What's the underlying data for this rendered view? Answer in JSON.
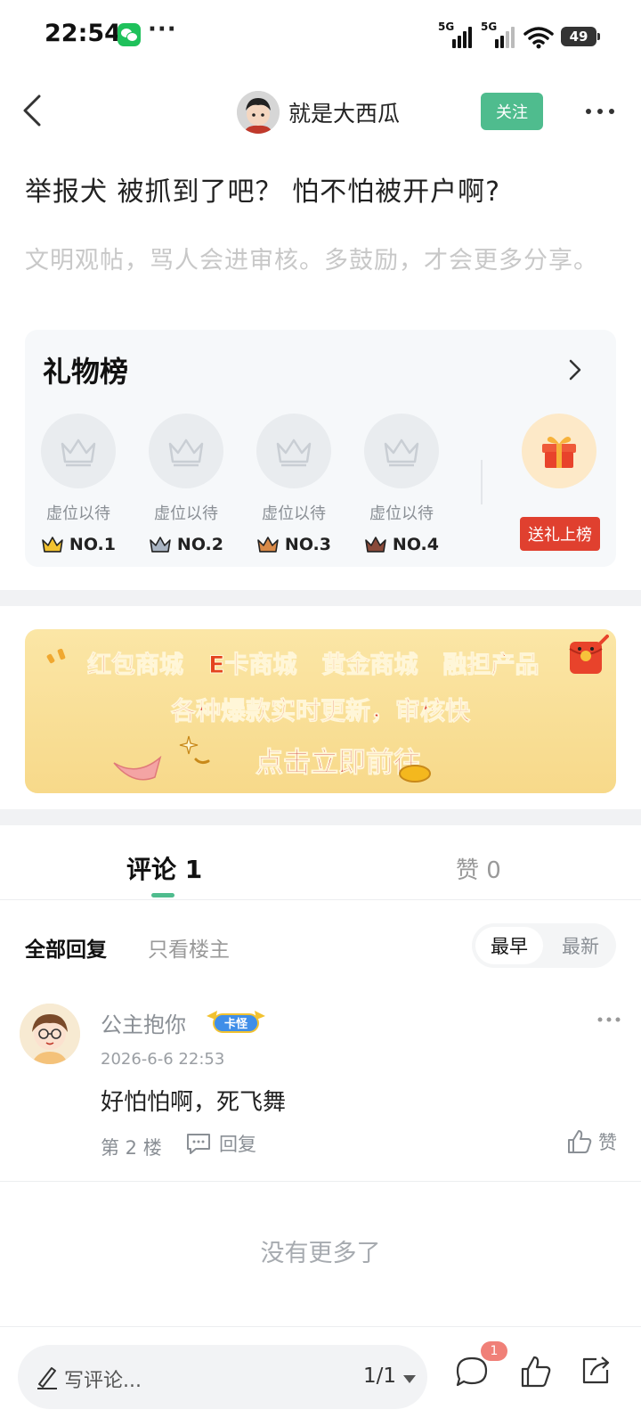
{
  "status_bar": {
    "time": "22:54",
    "more": "···",
    "net1": "5G",
    "net2": "5G",
    "battery": "49"
  },
  "header": {
    "author_name": "就是大西瓜",
    "follow_label": "关注"
  },
  "post": {
    "title": "举报犬 被抓到了吧？ 怕不怕被开户啊?",
    "hint": "文明观帖，骂人会进审核。多鼓励，才会更多分享。"
  },
  "gift_board": {
    "title": "礼物榜",
    "slots": [
      {
        "label": "虚位以待",
        "rank": "NO.1",
        "crown_color": "#f2c230"
      },
      {
        "label": "虚位以待",
        "rank": "NO.2",
        "crown_color": "#a9b4c2"
      },
      {
        "label": "虚位以待",
        "rank": "NO.3",
        "crown_color": "#d98a48"
      },
      {
        "label": "虚位以待",
        "rank": "NO.4",
        "crown_color": "#8a4a3a"
      }
    ],
    "send_label": "送礼上榜"
  },
  "banner": {
    "items": [
      "红包商城",
      "E卡商城",
      "黄金商城",
      "融担产品"
    ],
    "subtitle": "各种爆款实时更新，审核快",
    "cta": "点击立即前往"
  },
  "tabs": {
    "comments": "评论 1",
    "likes": "赞 0"
  },
  "filters": {
    "all": "全部回复",
    "owner_only": "只看楼主",
    "sort_earliest": "最早",
    "sort_latest": "最新"
  },
  "comments": [
    {
      "name": "公主抱你",
      "badge": "卡怪",
      "time": "2026-6-6 22:53",
      "text": "好怕怕啊，死飞舞",
      "floor": "第 2 楼",
      "reply_label": "回复",
      "like_label": "赞"
    }
  ],
  "no_more": "没有更多了",
  "bottom_bar": {
    "placeholder": "写评论...",
    "page": "1/1",
    "comment_badge": "1"
  },
  "colors": {
    "accent": "#4fbc8e",
    "send_gift": "#e0402f",
    "banner_bg": "#f7d98a"
  }
}
